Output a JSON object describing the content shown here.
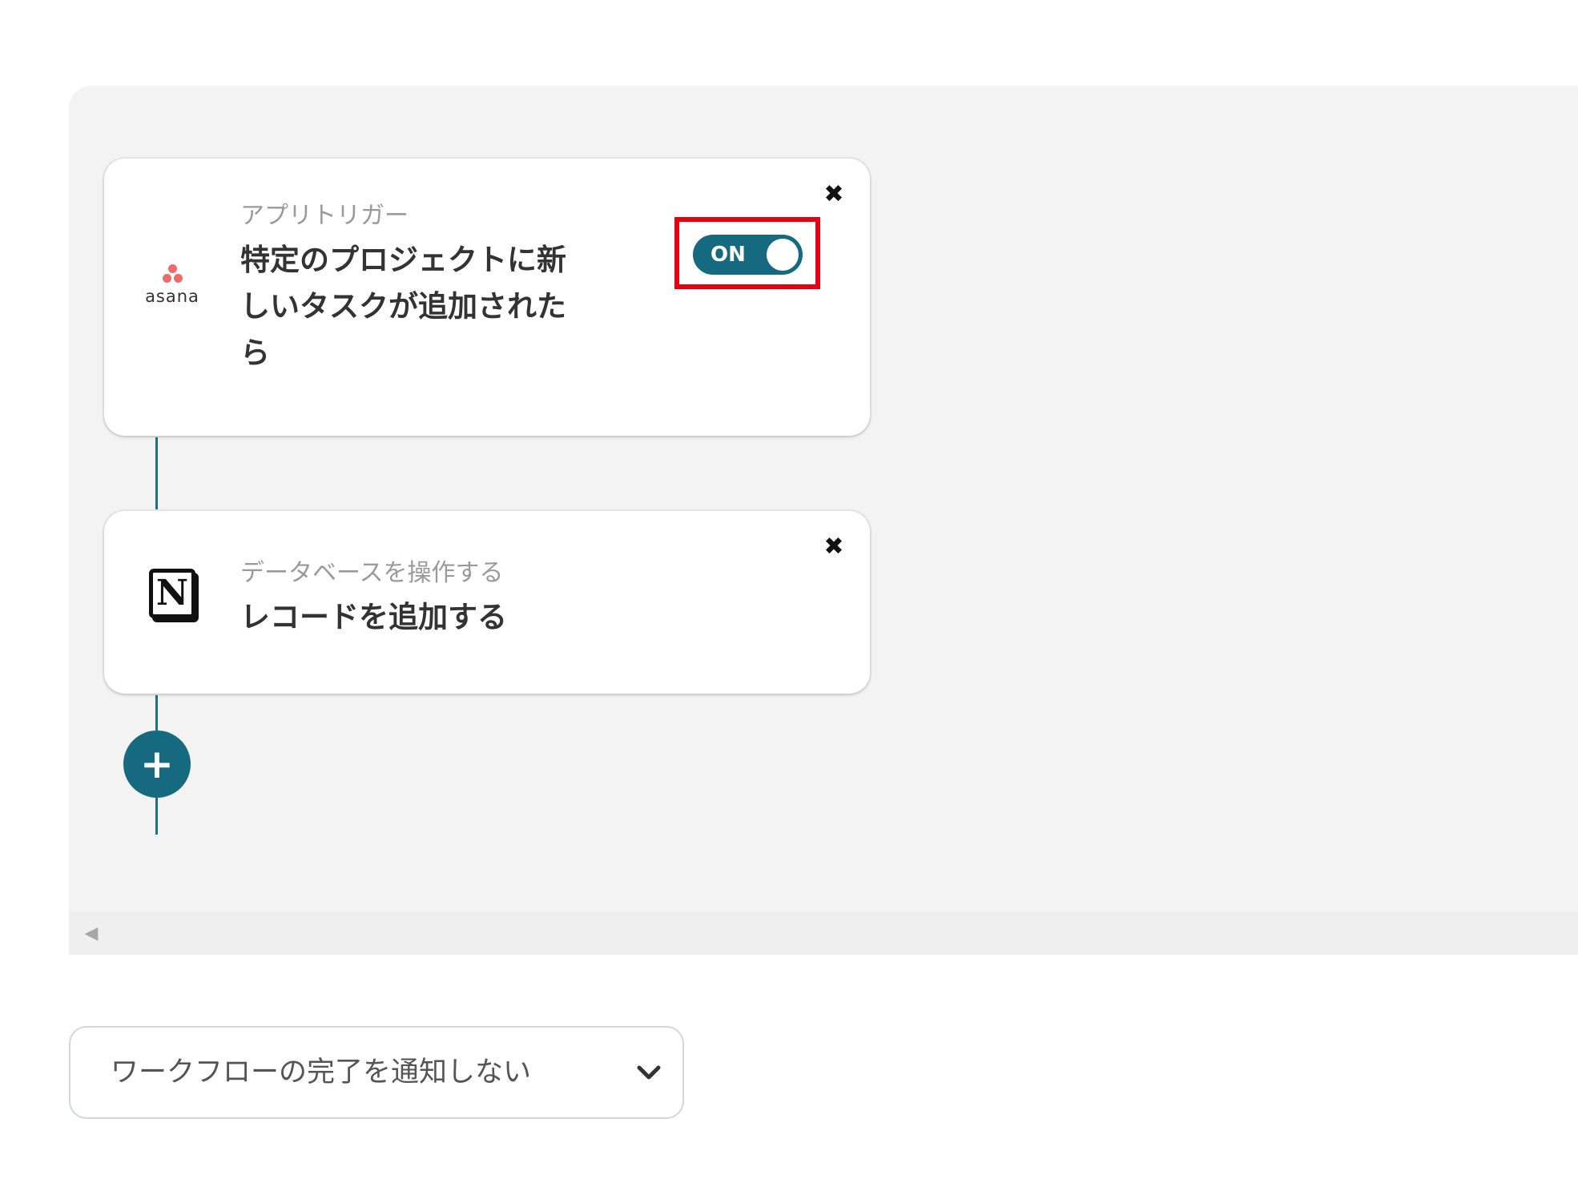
{
  "trigger_card": {
    "app": "asana",
    "kind": "アプリトリガー",
    "title": "特定のプロジェクトに新しいタスクが追加されたら",
    "toggle_label": "ON",
    "close_icon": "close-icon"
  },
  "action_card": {
    "app_logo_letter": "N",
    "kind": "データベースを操作する",
    "title": "レコードを追加する",
    "close_icon": "close-icon"
  },
  "add_step": {
    "icon": "plus-icon",
    "label": "+"
  },
  "notification_select": {
    "value": "ワークフローの完了を通知しない",
    "icon": "chevron-down-icon"
  },
  "colors": {
    "accent": "#156a80",
    "highlight": "#e60012",
    "asana": "#f06a6a",
    "canvas_bg": "#f3f3f3"
  }
}
